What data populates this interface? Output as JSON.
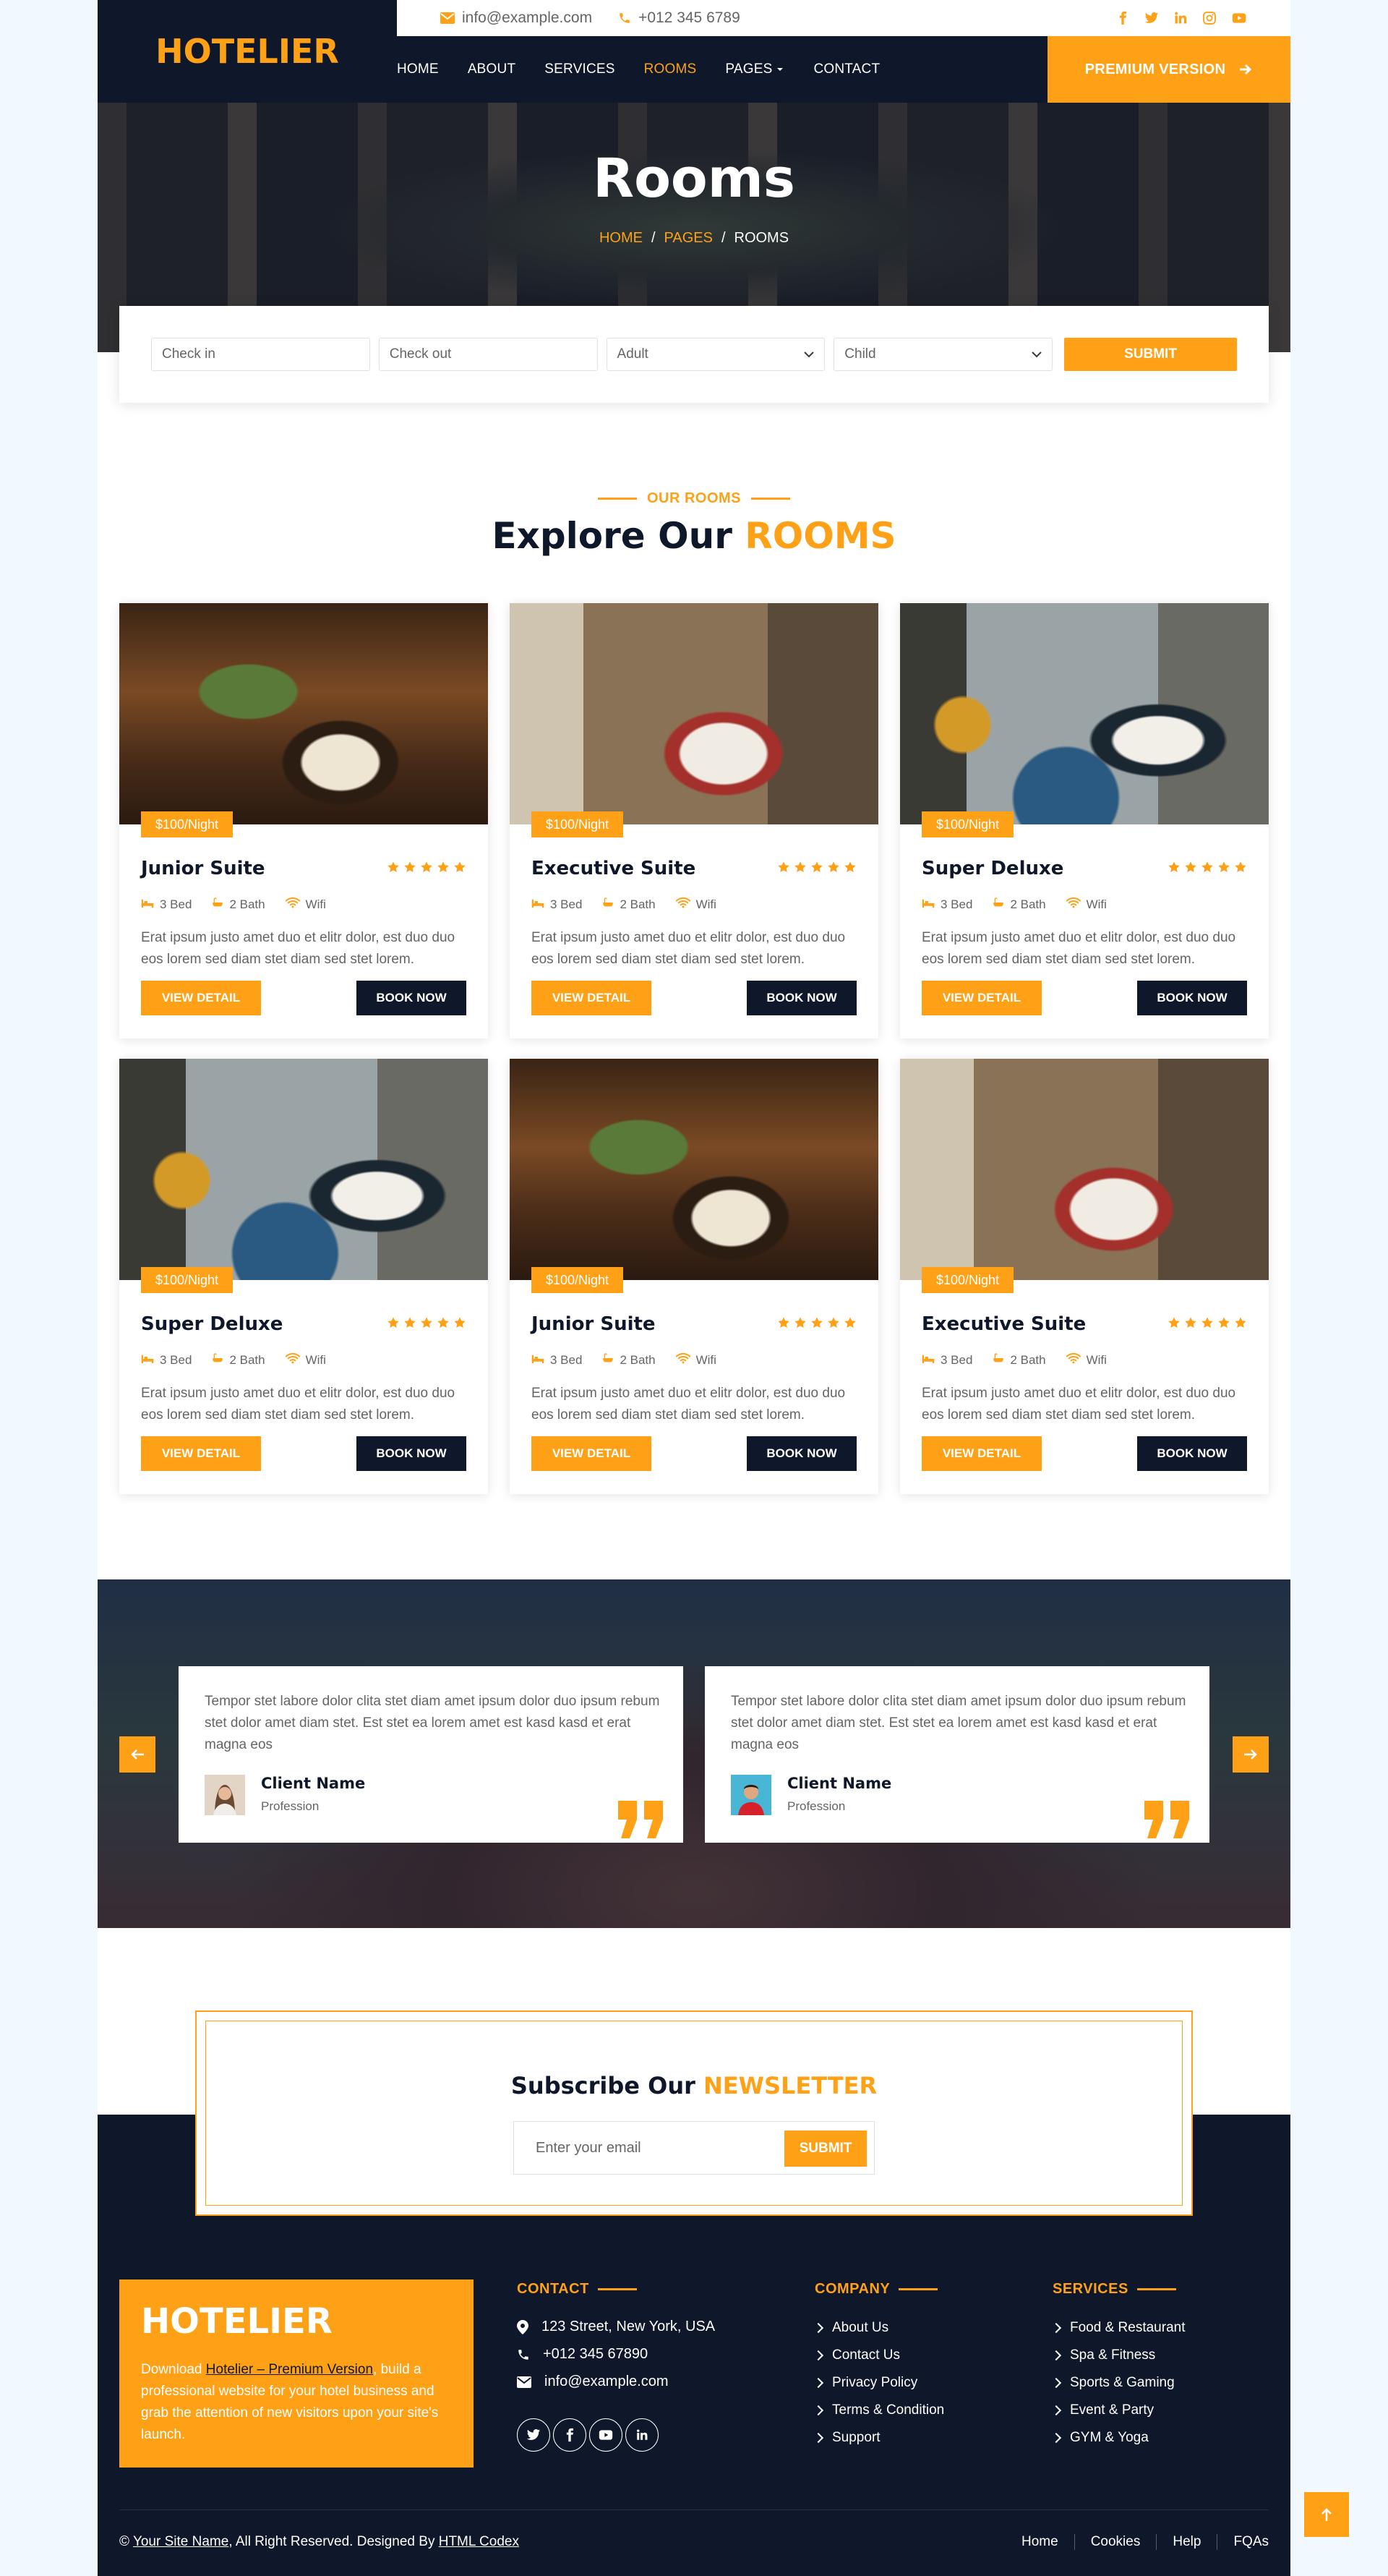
{
  "brand": {
    "name": "HOTELIER"
  },
  "topbar": {
    "email": "info@example.com",
    "phone": "+012 345 6789",
    "socials": [
      "facebook-icon",
      "twitter-icon",
      "linkedin-icon",
      "instagram-icon",
      "youtube-icon"
    ]
  },
  "nav": {
    "items": [
      "HOME",
      "ABOUT",
      "SERVICES",
      "ROOMS",
      "PAGES",
      "CONTACT"
    ],
    "active": "ROOMS",
    "premium": "PREMIUM VERSION"
  },
  "hero": {
    "title": "Rooms",
    "crumbs": [
      "HOME",
      "PAGES",
      "ROOMS"
    ]
  },
  "booking": {
    "checkin": "Check in",
    "checkout": "Check out",
    "adult": "Adult",
    "child": "Child",
    "submit": "SUBMIT"
  },
  "rooms_section": {
    "subtitle": "OUR ROOMS",
    "title_a": "Explore Our ",
    "title_b": "ROOMS"
  },
  "rooms": [
    {
      "price": "$100/Night",
      "name": "Junior Suite",
      "rating": 5,
      "bed": "3 Bed",
      "bath": "2 Bath",
      "wifi": "Wifi",
      "desc": "Erat ipsum justo amet duo et elitr dolor, est duo duo eos lorem sed diam stet diam sed stet lorem.",
      "view": "VIEW DETAIL",
      "book": "BOOK NOW"
    },
    {
      "price": "$100/Night",
      "name": "Executive Suite",
      "rating": 5,
      "bed": "3 Bed",
      "bath": "2 Bath",
      "wifi": "Wifi",
      "desc": "Erat ipsum justo amet duo et elitr dolor, est duo duo eos lorem sed diam stet diam sed stet lorem.",
      "view": "VIEW DETAIL",
      "book": "BOOK NOW"
    },
    {
      "price": "$100/Night",
      "name": "Super Deluxe",
      "rating": 5,
      "bed": "3 Bed",
      "bath": "2 Bath",
      "wifi": "Wifi",
      "desc": "Erat ipsum justo amet duo et elitr dolor, est duo duo eos lorem sed diam stet diam sed stet lorem.",
      "view": "VIEW DETAIL",
      "book": "BOOK NOW"
    },
    {
      "price": "$100/Night",
      "name": "Super Deluxe",
      "rating": 5,
      "bed": "3 Bed",
      "bath": "2 Bath",
      "wifi": "Wifi",
      "desc": "Erat ipsum justo amet duo et elitr dolor, est duo duo eos lorem sed diam stet diam sed stet lorem.",
      "view": "VIEW DETAIL",
      "book": "BOOK NOW"
    },
    {
      "price": "$100/Night",
      "name": "Junior Suite",
      "rating": 5,
      "bed": "3 Bed",
      "bath": "2 Bath",
      "wifi": "Wifi",
      "desc": "Erat ipsum justo amet duo et elitr dolor, est duo duo eos lorem sed diam stet diam sed stet lorem.",
      "view": "VIEW DETAIL",
      "book": "BOOK NOW"
    },
    {
      "price": "$100/Night",
      "name": "Executive Suite",
      "rating": 5,
      "bed": "3 Bed",
      "bath": "2 Bath",
      "wifi": "Wifi",
      "desc": "Erat ipsum justo amet duo et elitr dolor, est duo duo eos lorem sed diam stet diam sed stet lorem.",
      "view": "VIEW DETAIL",
      "book": "BOOK NOW"
    }
  ],
  "testimonials": [
    {
      "text": "Tempor stet labore dolor clita stet diam amet ipsum dolor duo ipsum rebum stet dolor amet diam stet. Est stet ea lorem amet est kasd kasd et erat magna eos",
      "name": "Client Name",
      "profession": "Profession"
    },
    {
      "text": "Tempor stet labore dolor clita stet diam amet ipsum dolor duo ipsum rebum stet dolor amet diam stet. Est stet ea lorem amet est kasd kasd et erat magna eos",
      "name": "Client Name",
      "profession": "Profession"
    }
  ],
  "newsletter": {
    "title_a": "Subscribe Our ",
    "title_b": "NEWSLETTER",
    "placeholder": "Enter your email",
    "submit": "SUBMIT"
  },
  "footer": {
    "brand": "HOTELIER",
    "about_a": "Download ",
    "about_link": "Hotelier – Premium Version",
    "about_b": ", build a professional website for your hotel business and grab the attention of new visitors upon your site's launch.",
    "contact_title": "CONTACT",
    "address": "123 Street, New York, USA",
    "phone": "+012 345 67890",
    "email": "info@example.com",
    "company_title": "COMPANY",
    "company_links": [
      "About Us",
      "Contact Us",
      "Privacy Policy",
      "Terms & Condition",
      "Support"
    ],
    "services_title": "SERVICES",
    "services_links": [
      "Food & Restaurant",
      "Spa & Fitness",
      "Sports & Gaming",
      "Event & Party",
      "GYM & Yoga"
    ],
    "copyright_pre": "© ",
    "site_name": "Your Site Name",
    "copyright_mid": ", All Right Reserved. Designed By ",
    "designer": "HTML Codex",
    "menu": [
      "Home",
      "Cookies",
      "Help",
      "FQAs"
    ]
  },
  "colors": {
    "primary": "#fea116",
    "dark": "#0f172b",
    "text": "#666565"
  }
}
